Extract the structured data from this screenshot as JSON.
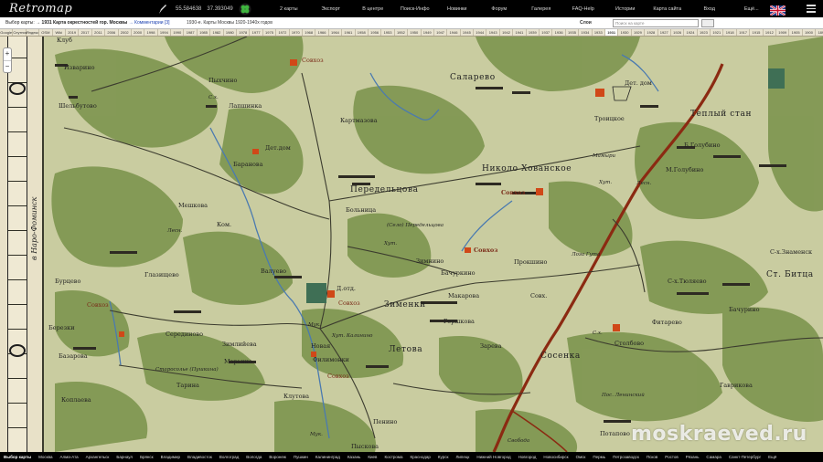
{
  "topbar": {
    "logo": "Retromap",
    "lat": "55.584638",
    "lon": "37.393049",
    "nav": [
      "2 карты",
      "Экспорт",
      "В центре",
      "Поиск-Инфо",
      "Новинки",
      "Форум",
      "Галерея",
      "FAQ-Help",
      "Истории",
      "Карта сайта",
      "Вход",
      "Ещё..."
    ]
  },
  "inforow": {
    "prefix": "Выбор карты: → ",
    "map_title": "1931 Карта окрестностей гор. Москвы",
    "comments": " → Комментарии [3]",
    "subtitle": "1930-е. Карты Москвы 1920-1940х годов",
    "layer_label": "Слои",
    "search_placeholder": "Поиск на карте"
  },
  "years": [
    "Google",
    "Спутник",
    "Яндекс",
    "OSM",
    "Wiki",
    "2019",
    "2017",
    "2011",
    "2006",
    "2002",
    "2000",
    "1998",
    "1994",
    "1990",
    "1987",
    "1985",
    "1982",
    "1980",
    "1978",
    "1977",
    "1975",
    "1972",
    "1970",
    "1968",
    "1966",
    "1964",
    "1961",
    "1958",
    "1956",
    "1953",
    "1952",
    "1950",
    "1949",
    "1947",
    "1946",
    "1945",
    "1944",
    "1943",
    "1942",
    "1941",
    "1939",
    "1937",
    "1936",
    "1935",
    "1934",
    "1933",
    "1931",
    "1930",
    "1929",
    "1928",
    "1927",
    "1926",
    "1924",
    "1923",
    "1921",
    "1918",
    "1917",
    "1915",
    "1912",
    "1909",
    "1905",
    "1900",
    "1897",
    "1891",
    "1887",
    "1880",
    "1872",
    "1860",
    "1852"
  ],
  "active_year": "1931",
  "frame": {
    "side_text": "в Наро-Фоминск"
  },
  "map_labels": [
    {
      "t": "Клуб",
      "c": "mid"
    },
    {
      "t": "Изварино",
      "c": "mid"
    },
    {
      "t": "Пыхчино",
      "c": "mid"
    },
    {
      "t": "Совхоз",
      "c": "mid red"
    },
    {
      "t": "Саларево",
      "c": "big"
    },
    {
      "t": "Шельбутово",
      "c": "mid"
    },
    {
      "t": "Лапшинка",
      "c": "mid"
    },
    {
      "t": "С.х.",
      "c": "sm"
    },
    {
      "t": "Картмазова",
      "c": "mid"
    },
    {
      "t": "Дет. дом",
      "c": "mid"
    },
    {
      "t": "Троицкое",
      "c": "mid"
    },
    {
      "t": "Теплый стан",
      "c": "big"
    },
    {
      "t": "Дет.дом",
      "c": "mid"
    },
    {
      "t": "Баранова",
      "c": "mid"
    },
    {
      "t": "Б.Голубино",
      "c": "mid"
    },
    {
      "t": "Николо Хованское",
      "c": "big"
    },
    {
      "t": "Мамыри",
      "c": "sm"
    },
    {
      "t": "М.Голубино",
      "c": "mid"
    },
    {
      "t": "Передельцова",
      "c": "big"
    },
    {
      "t": "Совхоз",
      "c": "mid red bold"
    },
    {
      "t": "Хут.",
      "c": "sm"
    },
    {
      "t": "Лесн.",
      "c": "sm"
    },
    {
      "t": "Мешкова",
      "c": "mid"
    },
    {
      "t": "Больница",
      "c": "mid"
    },
    {
      "t": "Ком.",
      "c": "mid"
    },
    {
      "t": "(Село) Передельцова",
      "c": "sm"
    },
    {
      "t": "Хут.",
      "c": "sm"
    },
    {
      "t": "Лесн.",
      "c": "sm"
    },
    {
      "t": "Совхоз",
      "c": "mid red bold"
    },
    {
      "t": "Прокшино",
      "c": "mid"
    },
    {
      "t": "Лоза Гута",
      "c": "sm"
    },
    {
      "t": "С-х.Знаменск",
      "c": "mid"
    },
    {
      "t": "Зимнино",
      "c": "mid"
    },
    {
      "t": "Глазищево",
      "c": "mid"
    },
    {
      "t": "Валуево",
      "c": "mid"
    },
    {
      "t": "Бачуркино",
      "c": "mid"
    },
    {
      "t": "Ст. Битца",
      "c": "big"
    },
    {
      "t": "Бурцево",
      "c": "mid"
    },
    {
      "t": "Д.отд.",
      "c": "mid"
    },
    {
      "t": "Совхоз",
      "c": "mid red"
    },
    {
      "t": "Совх.",
      "c": "mid"
    },
    {
      "t": "С-х.Тюляево",
      "c": "mid"
    },
    {
      "t": "Зименки",
      "c": "big"
    },
    {
      "t": "Макарова",
      "c": "mid"
    },
    {
      "t": "Фитарево",
      "c": "mid"
    },
    {
      "t": "Совхоз",
      "c": "mid red"
    },
    {
      "t": "Березки",
      "c": "mid"
    },
    {
      "t": "Мук.",
      "c": "sm"
    },
    {
      "t": "Горшкова",
      "c": "mid"
    },
    {
      "t": "Бачурино",
      "c": "mid"
    },
    {
      "t": "Серединово",
      "c": "mid"
    },
    {
      "t": "Зимлийева",
      "c": "mid"
    },
    {
      "t": "Хут. Калинино",
      "c": "sm"
    },
    {
      "t": "Новая",
      "c": "mid"
    },
    {
      "t": "Зарева",
      "c": "mid"
    },
    {
      "t": "С.х.",
      "c": "sm"
    },
    {
      "t": "Столбово",
      "c": "mid"
    },
    {
      "t": "Базарова",
      "c": "mid"
    },
    {
      "t": "Марьино",
      "c": "mid"
    },
    {
      "t": "Филимонки",
      "c": "mid"
    },
    {
      "t": "Летова",
      "c": "big"
    },
    {
      "t": "Сосенка",
      "c": "big"
    },
    {
      "t": "Старосолье (Пушкина)",
      "c": "sm"
    },
    {
      "t": "Тарина",
      "c": "mid"
    },
    {
      "t": "Совхоз",
      "c": "mid red"
    },
    {
      "t": "Коплаева",
      "c": "mid"
    },
    {
      "t": "Клутова",
      "c": "mid"
    },
    {
      "t": "Гаврикова",
      "c": "mid"
    },
    {
      "t": "Пос. Ленинский",
      "c": "sm"
    },
    {
      "t": "Пенино",
      "c": "mid"
    },
    {
      "t": "Мук.",
      "c": "sm"
    },
    {
      "t": "Свобода",
      "c": "sm"
    },
    {
      "t": "Потапово",
      "c": "mid"
    },
    {
      "t": "Пыскова",
      "c": "mid"
    }
  ],
  "bottombar": [
    "Выбор карты",
    "Москва",
    "Алма-Ата",
    "Архангельск",
    "Барнаул",
    "Брянск",
    "Владимир",
    "Владивосток",
    "Волгоград",
    "Вологда",
    "Воронеж",
    "Пушкин",
    "Калининград",
    "Казань",
    "Киев",
    "Кострома",
    "Краснодар",
    "Курск",
    "Липецк",
    "Нижний Новгород",
    "Новгород",
    "Новосибирск",
    "Омск",
    "Пермь",
    "Петрозаводск",
    "Псков",
    "Ростов",
    "Рязань",
    "Самара",
    "Санкт-Петербург",
    "Ещё"
  ],
  "watermark": "moskraeved.ru",
  "colors": {
    "map_green": "#7f9650",
    "map_field": "#c9cca0",
    "railway": "#8b2a12",
    "water": "#4a7ab0",
    "red_building": "#d04818"
  }
}
